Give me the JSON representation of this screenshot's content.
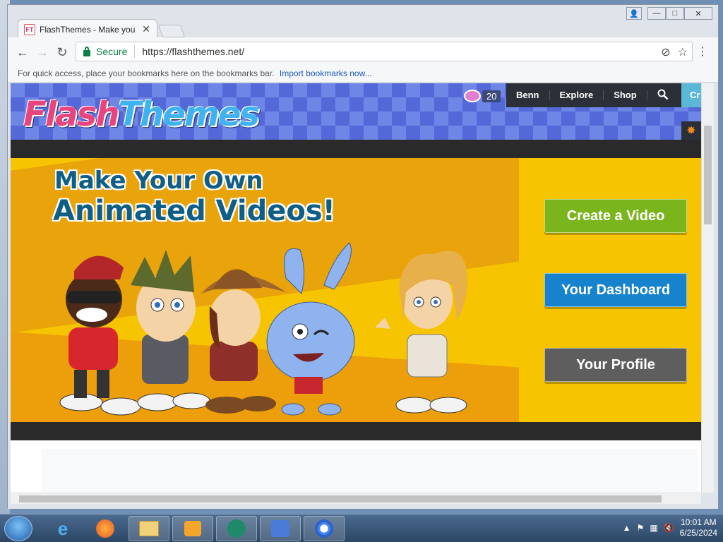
{
  "browser": {
    "tab_title": "FlashThemes - Make you",
    "tab_favicon": "FT",
    "security_label": "Secure",
    "url": "https://flashthemes.net/",
    "bookmarks_hint": "For quick access, place your bookmarks here on the bookmarks bar.",
    "import_link": "Import bookmarks now..."
  },
  "site": {
    "logo_part1": "Flash",
    "logo_part2": "Themes",
    "coin_count": "20",
    "nav": {
      "user": "Benn",
      "explore": "Explore",
      "shop": "Shop",
      "create_partial": "Cr"
    }
  },
  "hero": {
    "line1": "Make Your Own",
    "line2": "Animated Videos!",
    "buttons": {
      "create": "Create a Video",
      "dashboard": "Your Dashboard",
      "profile": "Your Profile"
    }
  },
  "taskbar": {
    "time": "10:01 AM",
    "date": "6/25/2024"
  },
  "colors": {
    "hero_bg": "#f6c400",
    "create_btn": "#7ab51d",
    "dashboard_btn": "#1683cc",
    "profile_btn": "#5e5e5e",
    "headline": "#0f5e86"
  }
}
